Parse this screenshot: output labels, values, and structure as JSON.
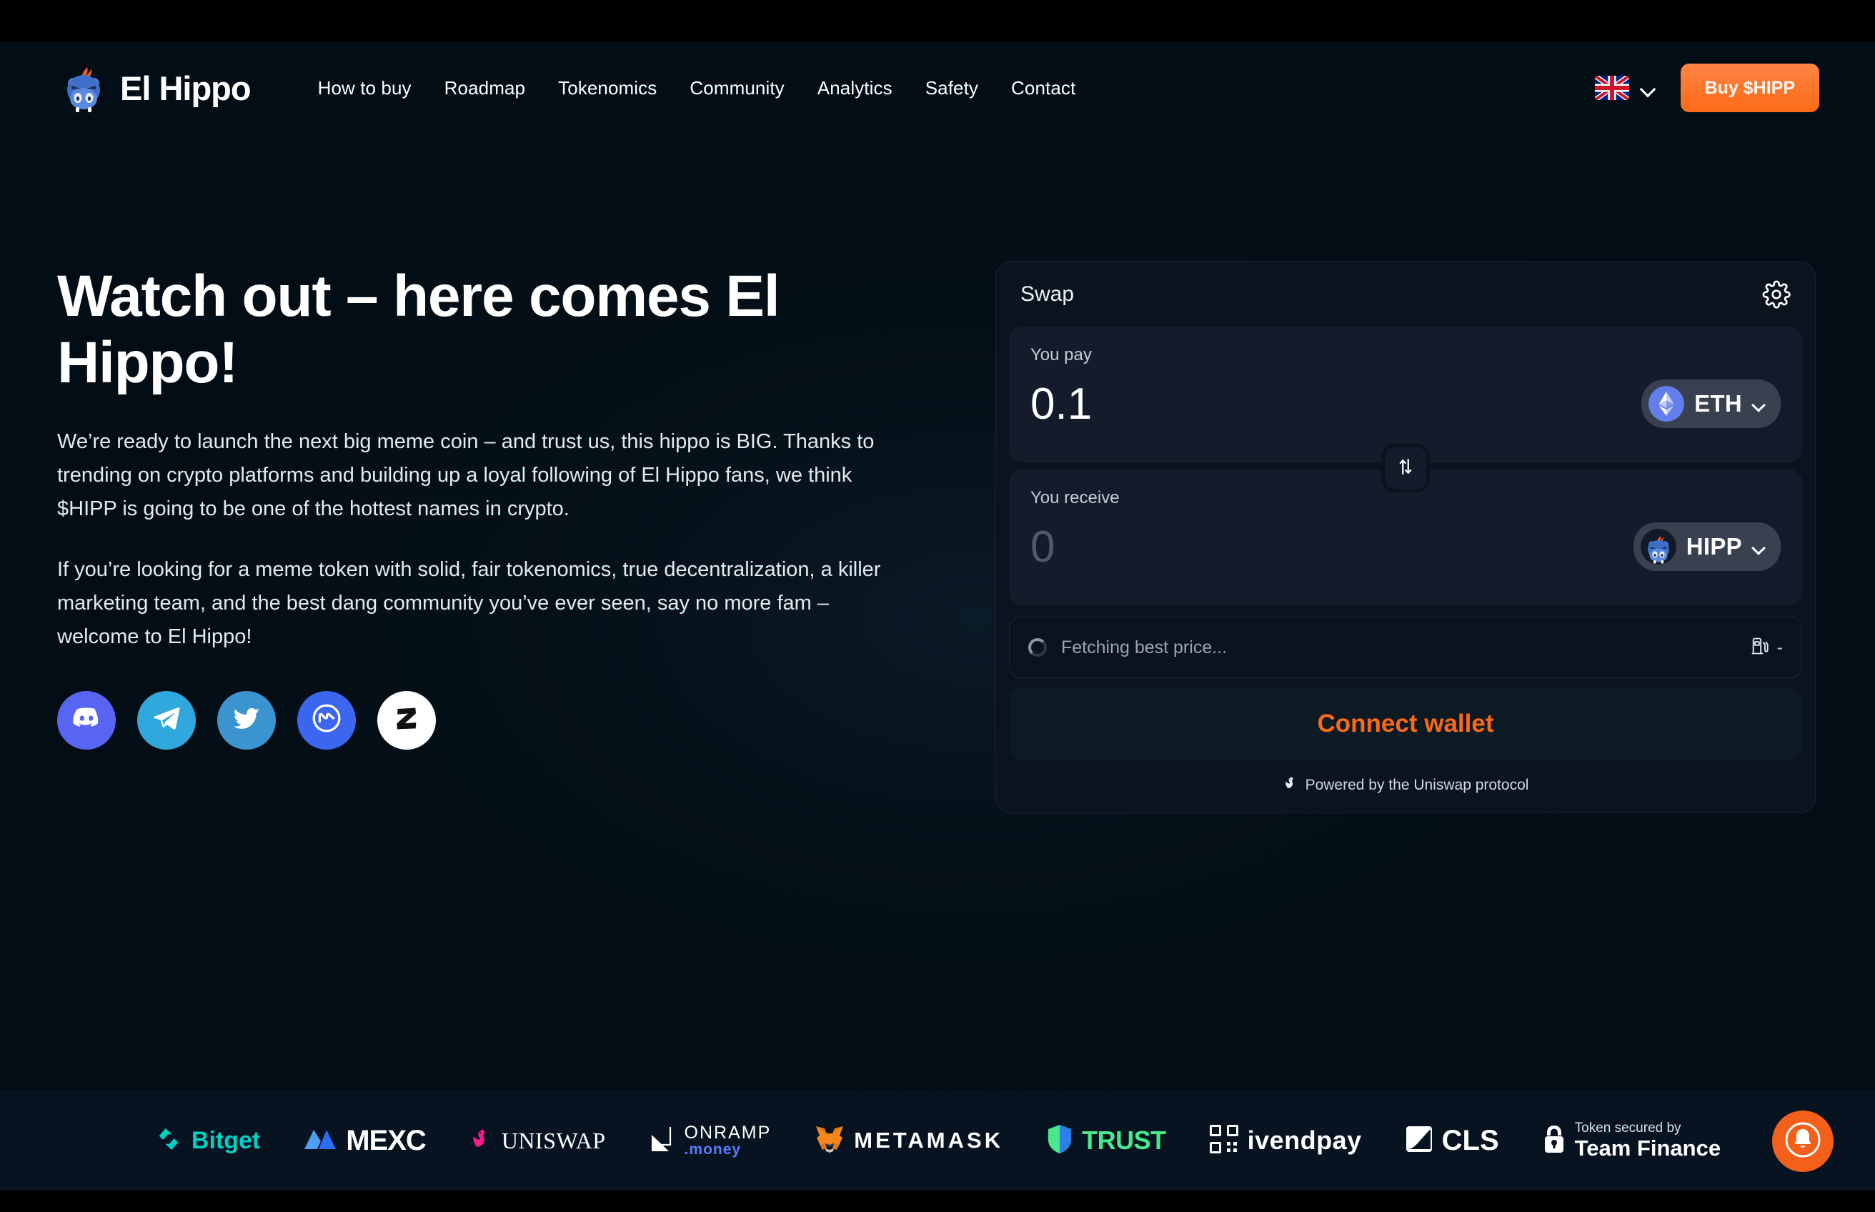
{
  "brand": {
    "name": "El Hippo",
    "logo_icon": "hippo-logo-icon"
  },
  "nav": {
    "items": [
      {
        "label": "How to buy"
      },
      {
        "label": "Roadmap"
      },
      {
        "label": "Tokenomics"
      },
      {
        "label": "Community"
      },
      {
        "label": "Analytics"
      },
      {
        "label": "Safety"
      },
      {
        "label": "Contact"
      }
    ]
  },
  "header": {
    "language": {
      "flag": "uk-flag-icon",
      "chevron": "chevron-down-icon"
    },
    "buy_button": "Buy $HIPP"
  },
  "hero": {
    "heading": "Watch out – here comes El Hippo!",
    "paragraph_1": "We’re ready to launch the next big meme coin – and trust us, this hippo is BIG. Thanks to trending on crypto platforms and building up a loyal following of El Hippo fans, we think $HIPP is going to be one of the hottest names in crypto.",
    "paragraph_2": "If you’re looking for a meme token with solid, fair tokenomics, true decentralization, a killer marketing team, and the best dang community you’ve ever seen, say no more fam – welcome to El Hippo!",
    "socials": [
      {
        "name": "discord",
        "icon": "discord-icon",
        "color": "#5865f2"
      },
      {
        "name": "telegram",
        "icon": "telegram-icon",
        "color": "#31a8dd"
      },
      {
        "name": "twitter",
        "icon": "twitter-icon",
        "color": "#3b93cf"
      },
      {
        "name": "coinmarketcap",
        "icon": "coinmarketcap-icon",
        "color": "#3a66f0"
      },
      {
        "name": "zealy",
        "icon": "zealy-icon",
        "color": "#ffffff"
      }
    ]
  },
  "swap": {
    "title": "Swap",
    "settings_icon": "gear-icon",
    "pay": {
      "label": "You pay",
      "amount": "0.1",
      "token": "ETH",
      "token_icon": "ethereum-icon"
    },
    "receive": {
      "label": "You receive",
      "amount": "0",
      "token": "HIPP",
      "token_icon": "hippo-token-icon"
    },
    "toggle_icon": "swap-direction-icon",
    "price_status": "Fetching best price...",
    "gas_icon": "gas-pump-icon",
    "gas_value": "-",
    "connect_button": "Connect wallet",
    "powered_by": "Powered by the Uniswap protocol",
    "powered_icon": "uniswap-unicorn-icon"
  },
  "partners": [
    {
      "name": "Bitget",
      "icon": "bitget-icon",
      "color": "#00d0c3"
    },
    {
      "name": "MEXC",
      "icon": "mexc-icon",
      "color": "#2a6df4"
    },
    {
      "name": "UNISWAP",
      "icon": "uniswap-icon",
      "color": "#ff1a8c"
    },
    {
      "name": "ONRAMP",
      "sub": ".money",
      "icon": "onramp-icon",
      "color": "#ffffff"
    },
    {
      "name": "METAMASK",
      "icon": "metamask-fox-icon",
      "color": "#e2761b"
    },
    {
      "name": "TRUST",
      "icon": "trust-shield-icon",
      "color": "#48e98a"
    },
    {
      "name": "ivendpay",
      "icon": "ivendpay-qr-icon",
      "color": "#ffffff"
    },
    {
      "name": "CLS",
      "icon": "cls-icon",
      "color": "#ffffff"
    },
    {
      "name": "Team Finance",
      "sub": "Token secured by",
      "icon": "lock-icon",
      "color": "#ffffff"
    }
  ],
  "notification": {
    "icon": "bell-icon",
    "color": "#f4601a"
  }
}
